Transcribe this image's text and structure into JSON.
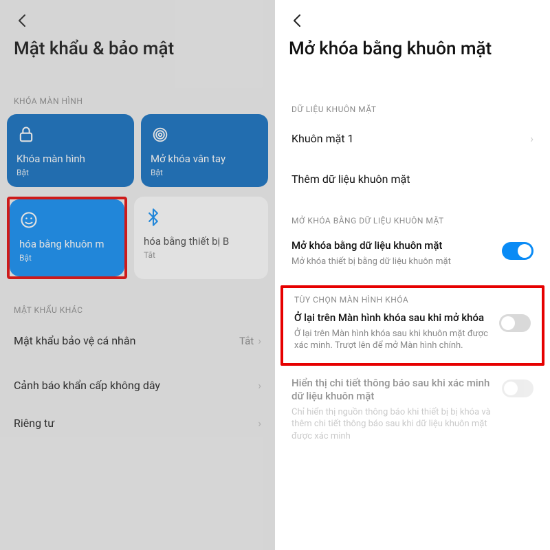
{
  "left": {
    "title": "Mật khẩu & bảo mật",
    "section_lock": "KHÓA MÀN HÌNH",
    "tiles": {
      "lock": {
        "title": "Khóa màn hình",
        "sub": "Bật"
      },
      "finger": {
        "title": "Mở khóa vân tay",
        "sub": "Bật"
      },
      "face": {
        "title": "hóa bằng khuôn m",
        "sub": "Bật"
      },
      "bt": {
        "title": "hóa bằng thiết bị B",
        "sub": "Tắt"
      }
    },
    "section_other": "MẬT KHẨU KHÁC",
    "rows": {
      "privacy_pw": {
        "label": "Mật khẩu bảo vệ cá nhân",
        "status": "Tắt"
      },
      "emergency": {
        "label": "Cảnh báo khẩn cấp không dây"
      },
      "private": {
        "label": "Riêng tư"
      }
    }
  },
  "right": {
    "title": "Mở khóa bằng khuôn mặt",
    "section_facedata": "DỮ LIỆU KHUÔN MẶT",
    "face1": "Khuôn mặt 1",
    "add_face": "Thêm dữ liệu khuôn mặt",
    "section_unlock": "MỞ KHÓA BẰNG DỮ LIỆU KHUÔN MẶT",
    "unlock_face": {
      "title": "Mở khóa bằng dữ liệu khuôn mặt",
      "desc": "Mở khóa thiết bị bằng dữ liệu khuôn mặt"
    },
    "section_lockopt": "TÙY CHỌN MÀN HÌNH KHÓA",
    "stay": {
      "title": "Ở lại trên Màn hình khóa sau khi mở khóa",
      "desc": "Ở lại trên Màn hình khóa sau khi khuôn mặt được xác minh. Trượt lên để mở Màn hình chính."
    },
    "notif": {
      "title": "Hiển thị chi tiết thông báo sau khi xác minh dữ liệu khuôn mặt",
      "desc": "Chỉ hiển thị nguồn thông báo khi thiết bị bị khóa và thêm chi tiết thông báo sau khi dữ liệu khuôn mặt được xác minh"
    }
  }
}
